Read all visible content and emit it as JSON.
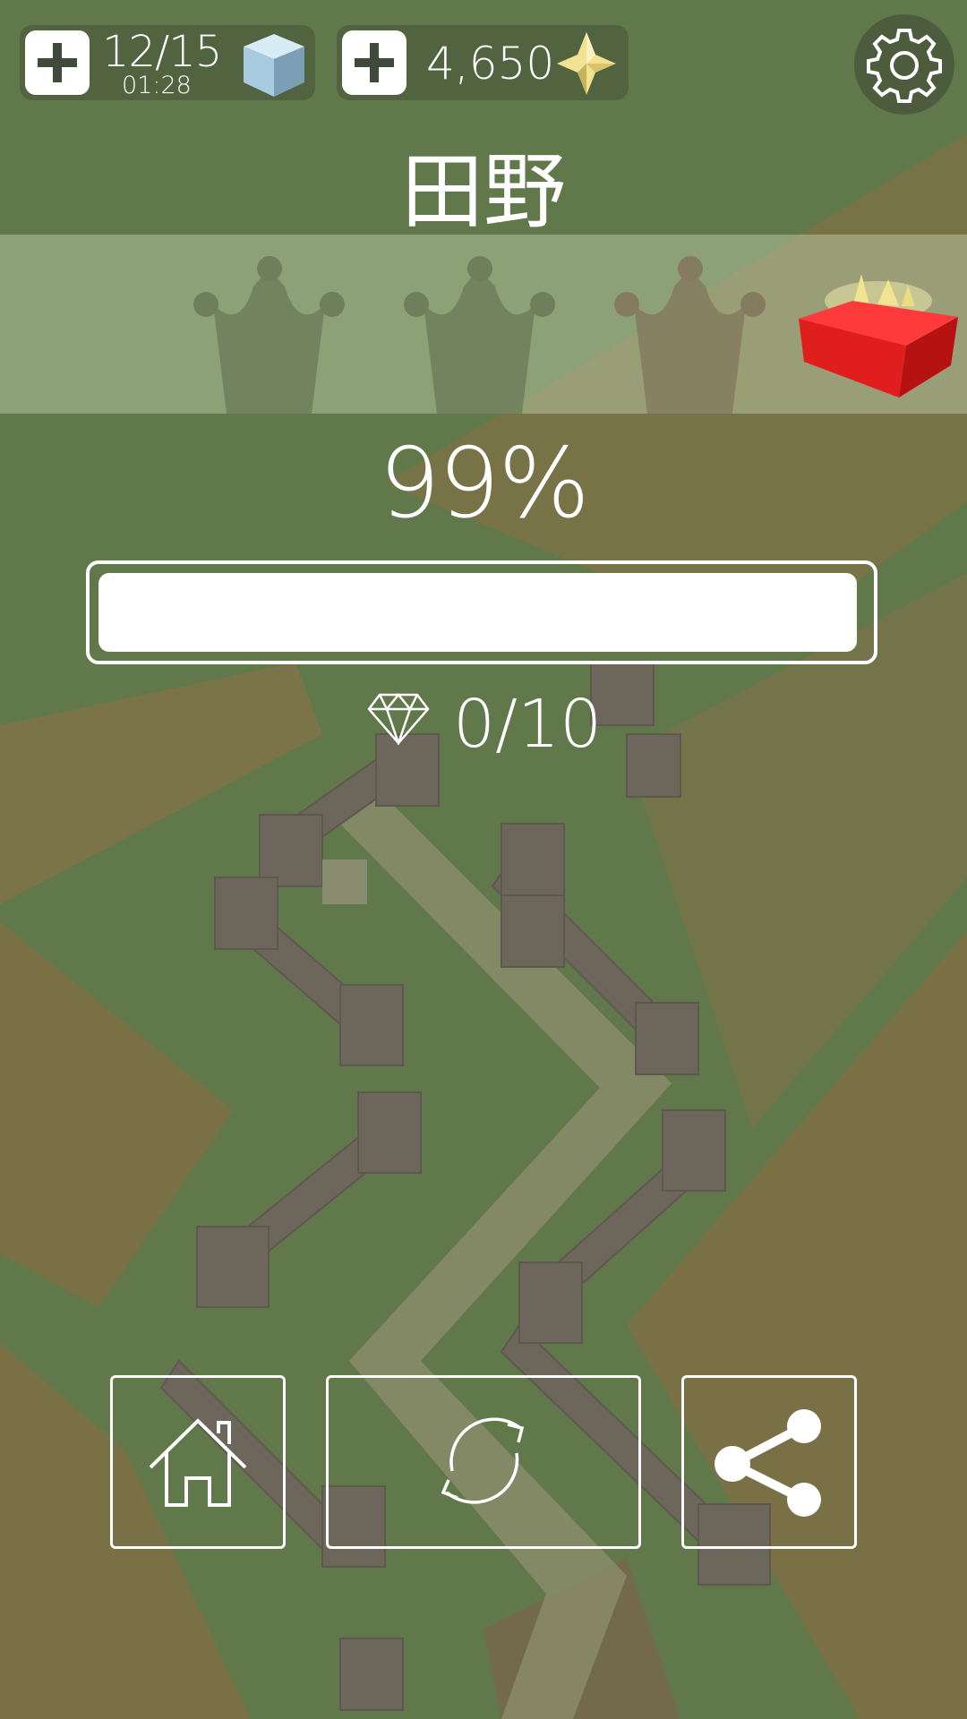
{
  "hud": {
    "energy": {
      "count": "12/15",
      "timer": "01:28",
      "icon": "ice-cube-icon"
    },
    "coins": {
      "count": "4,650",
      "icon": "gold-star-icon"
    },
    "settings_icon": "gear-icon"
  },
  "level": {
    "title": "田野",
    "crowns_earned": 0,
    "crowns_total": 3,
    "reward_icon": "red-gift-box-icon"
  },
  "progress": {
    "percent_text": "99%",
    "fraction": 0.99
  },
  "gems": {
    "count": "0/10",
    "icon": "diamond-icon"
  },
  "actions": [
    "home-icon",
    "restart-icon",
    "share-icon"
  ],
  "colors": {
    "grass": "#61794a",
    "field": "#7a7247",
    "fence": "#6d665a",
    "gift": "#e01e1e",
    "star": "#f2e392"
  }
}
